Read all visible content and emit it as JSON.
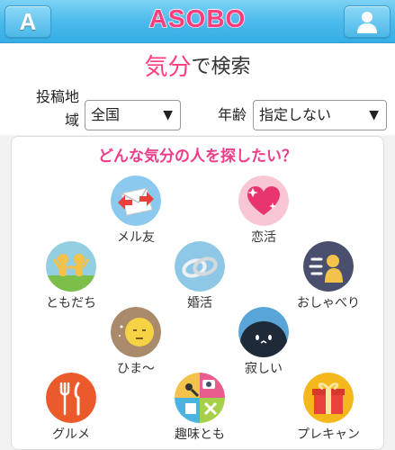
{
  "header": {
    "left_button_letter": "A",
    "logo": "ASOBO",
    "profile_icon": "user-silhouette-icon",
    "colors": {
      "bar": "#48b9eb",
      "logo": "#ff3d7f"
    }
  },
  "title": {
    "highlight": "気分",
    "rest": "で検索"
  },
  "filters": {
    "area_label": "投稿地域",
    "area_value": "全国",
    "age_label": "年齢",
    "age_value": "指定しない",
    "arrow": "▼"
  },
  "question": "どんな気分の人を探したい？",
  "moods": [
    {
      "label": "メル友",
      "icon": "envelope-icon"
    },
    {
      "label": "恋活",
      "icon": "heart-icon"
    },
    {
      "label": "ともだち",
      "icon": "friends-icon"
    },
    {
      "label": "婚活",
      "icon": "rings-icon"
    },
    {
      "label": "おしゃべり",
      "icon": "chat-person-icon"
    },
    {
      "label": "ひま～",
      "icon": "moon-icon"
    },
    {
      "label": "寂しい",
      "icon": "lonely-face-icon"
    },
    {
      "label": "グルメ",
      "icon": "cutlery-icon"
    },
    {
      "label": "趣味とも",
      "icon": "hobby-icon"
    },
    {
      "label": "プレキャン",
      "icon": "gift-icon"
    }
  ]
}
